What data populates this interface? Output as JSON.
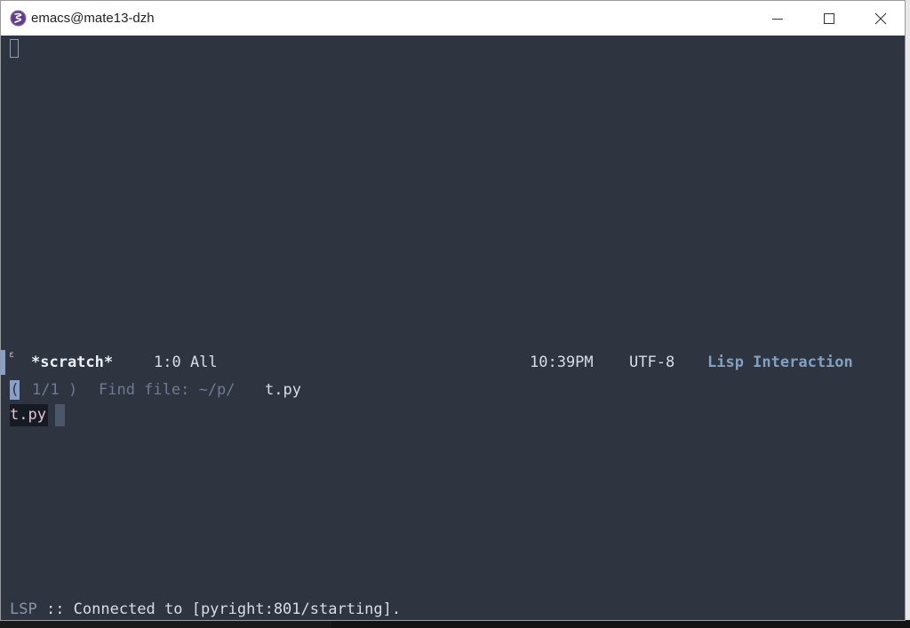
{
  "window": {
    "title": "emacs@mate13-dzh",
    "app_icon": "emacs-icon"
  },
  "modeline": {
    "buffer_name": "*scratch*",
    "position": "1:0 All",
    "time": "10:39PM",
    "encoding": "UTF-8",
    "major_mode": "Lisp Interaction"
  },
  "minibuffer": {
    "open_paren": "(",
    "count": "1/1 )",
    "prompt": "Find file: ~/p/",
    "input": "t.py"
  },
  "completion": {
    "candidates": [
      "t.py"
    ]
  },
  "echo_area": {
    "prefix": "LSP",
    "message": " :: Connected to [pyright:801/starting]."
  },
  "colors": {
    "background": "#2e3440",
    "accent": "#81a1c1",
    "titlebar": "#ffffff"
  }
}
